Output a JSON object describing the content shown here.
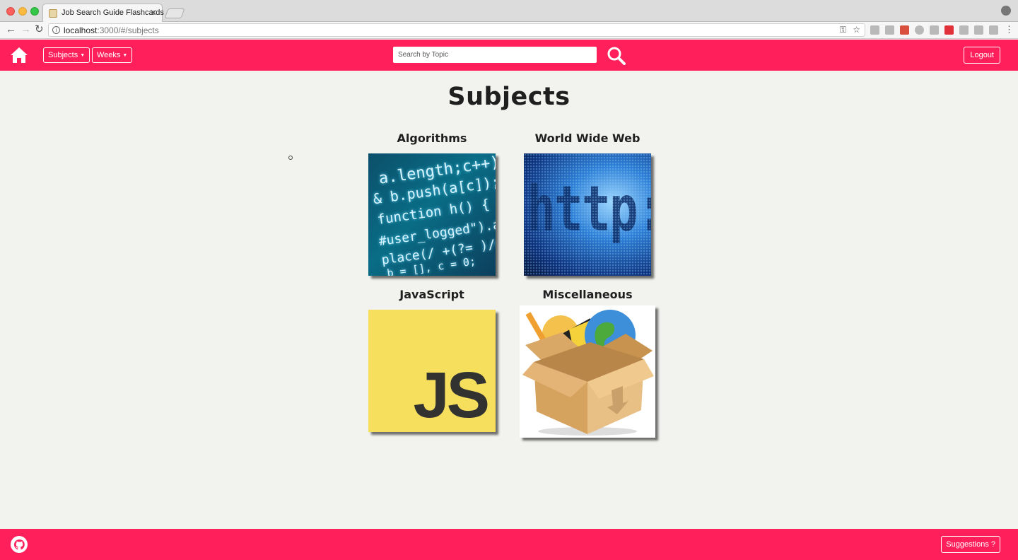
{
  "browser": {
    "tab_title": "Job Search Guide Flashcards",
    "tab_close": "✕",
    "url_host": "localhost",
    "url_rest": ":3000/#/subjects"
  },
  "navbar": {
    "subjects_label": "Subjects",
    "weeks_label": "Weeks",
    "search_placeholder": "Search by Topic",
    "logout_label": "Logout"
  },
  "main": {
    "title": "Subjects",
    "subjects": [
      {
        "label": "Algorithms",
        "image": "code-screen"
      },
      {
        "label": "World Wide Web",
        "image": "http-www"
      },
      {
        "label": "JavaScript",
        "image": "js-logo"
      },
      {
        "label": "Miscellaneous",
        "image": "cardboard-box"
      }
    ],
    "code_lines": [
      "a.length;c++) {",
      "& b.push(a[c]);",
      "function h() {",
      "#user_logged\").a(),",
      "place(/ +(?= )/g,",
      "b = [], c = 0;"
    ],
    "http_text": "http://www",
    "js_text": "JS"
  },
  "footer": {
    "suggestions_label": "Suggestions ?"
  },
  "colors": {
    "brand": "#ff1f5a",
    "background": "#f2f2ef",
    "js_yellow": "#f7df5e"
  }
}
